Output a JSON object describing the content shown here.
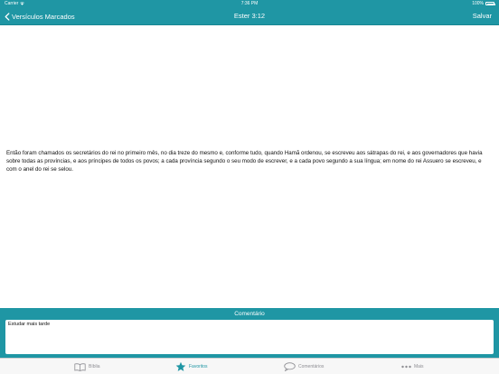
{
  "status_bar": {
    "carrier": "Carrier",
    "time": "7:36 PM",
    "battery": "100%"
  },
  "nav": {
    "back_label": "Versículos Marcados",
    "title": "Ester 3:12",
    "save_label": "Salvar"
  },
  "verse": {
    "text": "Então foram chamados os secretários do rei no primeiro mês, no dia treze do mesmo e, conforme tudo, quando Hamã ordenou, se escreveu aos sátrapas do rei, e aos governadores que havia sobre todas as províncias, e aos príncipes de todos os povos; a cada província segundo o seu modo de escrever, e a cada povo segundo a sua língua; em nome do rei Assuero se escreveu, e com o anel do rei se selou."
  },
  "comment": {
    "header": "Comentário",
    "value": "Estudar mais tarde"
  },
  "tabs": [
    {
      "label": "Bíblia",
      "icon": "book-icon",
      "active": false
    },
    {
      "label": "Favoritos",
      "icon": "star-icon",
      "active": true
    },
    {
      "label": "Comentários",
      "icon": "speech-bubble-icon",
      "active": false
    },
    {
      "label": "Mais",
      "icon": "more-icon",
      "active": false
    }
  ],
  "colors": {
    "accent": "#1f96a4",
    "tab_inactive": "#8e8e93"
  }
}
